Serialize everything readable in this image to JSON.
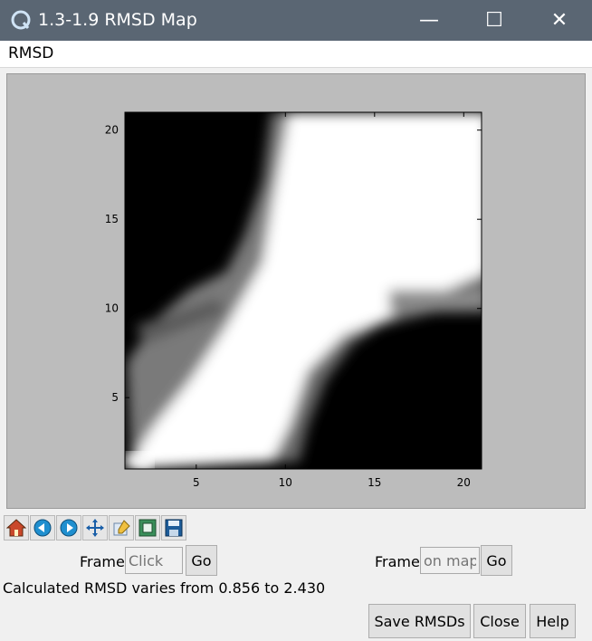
{
  "window": {
    "title": "1.3-1.9 RMSD Map",
    "minimize_glyph": "—",
    "maximize_glyph": "☐",
    "close_glyph": "✕"
  },
  "menu": {
    "label": "RMSD"
  },
  "chart_data": {
    "type": "heatmap",
    "title": "",
    "xlabel": "",
    "ylabel": "",
    "xlim": [
      1,
      21
    ],
    "ylim": [
      1,
      21
    ],
    "x_ticks": [
      "5",
      "10",
      "15",
      "20"
    ],
    "y_ticks": [
      "5",
      "10",
      "15",
      "20"
    ],
    "colormap": "grayscale (white = low RMSD, black = high RMSD)",
    "rmsd_min": 0.856,
    "rmsd_max": 2.43
  },
  "toolbar": {
    "icons": [
      "home-icon",
      "back-icon",
      "forward-icon",
      "pan-icon",
      "configure-icon",
      "zoom-icon",
      "save-icon"
    ]
  },
  "frame_left": {
    "label": "Frame",
    "placeholder": "Click",
    "go": "Go"
  },
  "frame_right": {
    "label": "Frame",
    "placeholder": "on map",
    "go": "Go"
  },
  "status": "Calculated RMSD varies from 0.856 to 2.430",
  "buttons": {
    "save": "Save RMSDs",
    "close": "Close",
    "help": "Help"
  }
}
